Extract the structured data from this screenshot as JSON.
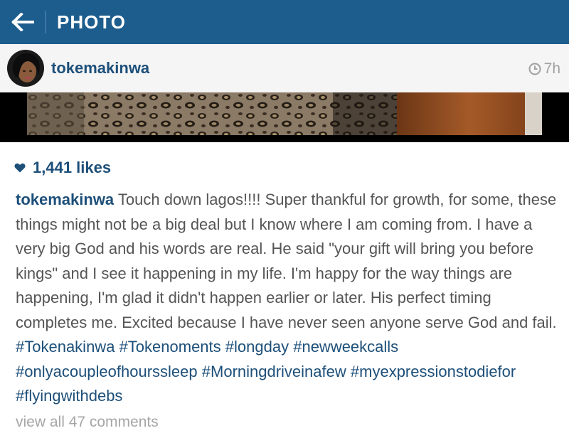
{
  "header": {
    "title": "PHOTO",
    "back_icon": "arrow-left-icon",
    "background": "#1d5d8e"
  },
  "post": {
    "username": "tokemakinwa",
    "timestamp": "7h",
    "clock_icon": "clock-icon",
    "photo_description": "leopard-print-photo",
    "likes_icon": "heart-icon",
    "likes": "1,441 likes",
    "caption": {
      "username": "tokemakinwa",
      "text": " Touch down lagos!!!! Super thankful for growth, for some, these things might not be a big deal but I know where I am coming from. I have a very big God and his words are real. He said \"your gift will bring you before kings\" and I see it happening in my life. I'm happy for the way things are happening, I'm glad it didn't happen earlier or later. His perfect timing completes me. Excited because I have never seen anyone serve God and fail. ",
      "hashtags": [
        "#Tokenakinwa",
        "#Tokenoments",
        "#longday",
        "#newweekcalls",
        "#onlyacoupleofhourssleep",
        "#Morningdriveinafew",
        "#myexpressionstodiefor",
        "#flyingwithdebs"
      ]
    },
    "comments_link": "view all 47 comments"
  },
  "colors": {
    "brand": "#1d5d8e",
    "link": "#1d4f79",
    "body_text": "#555555",
    "muted": "#a0a0a0"
  }
}
